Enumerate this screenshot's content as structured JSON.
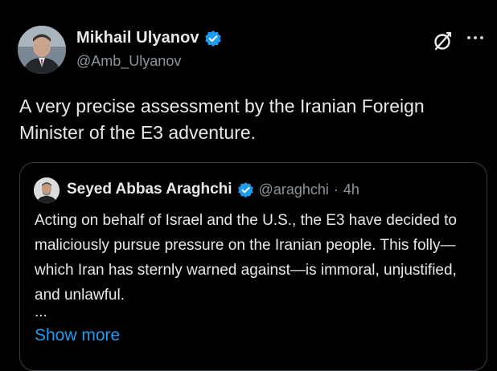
{
  "author": {
    "name": "Mikhail Ulyanov",
    "handle": "@Amb_Ulyanov",
    "verified": true
  },
  "icons": {
    "verified": "verified-badge-icon",
    "grok": "grok-icon",
    "more": "more-options-icon"
  },
  "tweet": {
    "text": "A very precise assessment by the Iranian Foreign Minister of the E3 adventure."
  },
  "quote": {
    "name": "Seyed Abbas Araghchi",
    "handle": "@araghchi",
    "separator": "·",
    "time": "4h",
    "verified": true,
    "text": "Acting on behalf of Israel and the U.S., the E3 have decided to maliciously pursue pressure on the Iranian people. This folly—which Iran has sternly warned against—is immoral, unjustified, and unlawful.",
    "ellipsis": "...",
    "show_more": "Show more"
  },
  "colors": {
    "background": "#000000",
    "text": "#e7e9ea",
    "secondary": "#8b949b",
    "link": "#1d9bf0",
    "verified": "#1d9bf0",
    "border": "#3a3f44"
  }
}
